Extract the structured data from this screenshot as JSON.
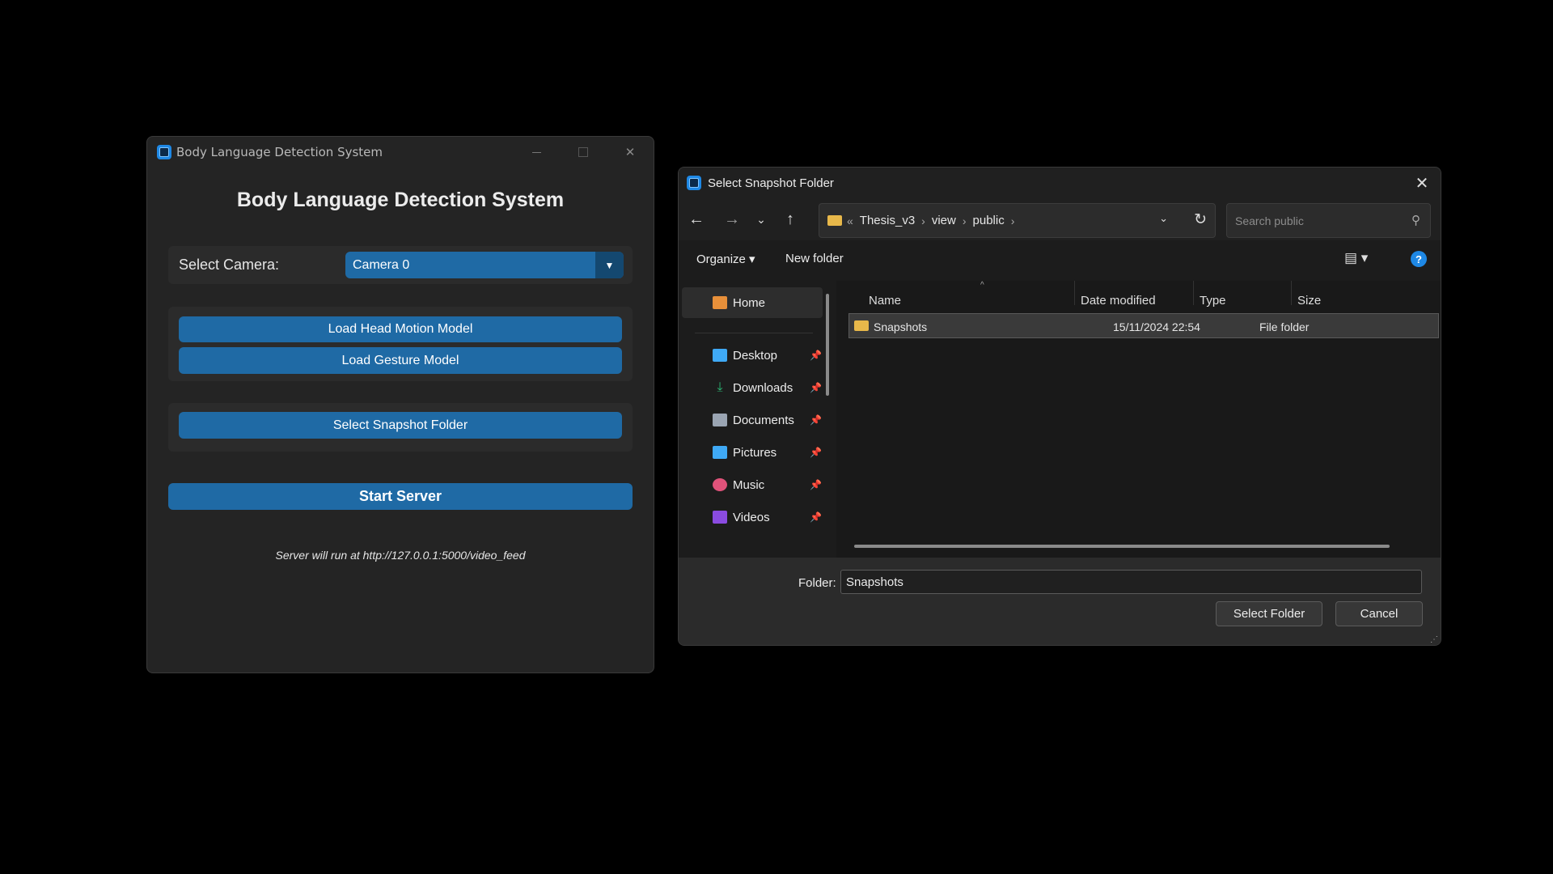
{
  "app": {
    "window_title": "Body Language Detection System",
    "heading": "Body Language Detection System",
    "camera_label": "Select Camera:",
    "camera_value": "Camera 0",
    "load_head_btn": "Load Head Motion Model",
    "load_gesture_btn": "Load Gesture Model",
    "select_snapshot_btn": "Select Snapshot Folder",
    "start_server_btn": "Start Server",
    "server_note": "Server will run at http://127.0.0.1:5000/video_feed",
    "accent_color": "#1f6aa5"
  },
  "dialog": {
    "title": "Select Snapshot Folder",
    "breadcrumb": [
      "Thesis_v3",
      "view",
      "public"
    ],
    "search_placeholder": "Search public",
    "organize": "Organize",
    "new_folder": "New folder",
    "nav": {
      "home": "Home",
      "items": [
        {
          "label": "Desktop",
          "icon": "desktop-icon",
          "color": "#3fa9f5"
        },
        {
          "label": "Downloads",
          "icon": "download-icon",
          "color": "#2bb673"
        },
        {
          "label": "Documents",
          "icon": "documents-icon",
          "color": "#9aa4b2"
        },
        {
          "label": "Pictures",
          "icon": "pictures-icon",
          "color": "#3fa9f5"
        },
        {
          "label": "Music",
          "icon": "music-icon",
          "color": "#e0527a"
        },
        {
          "label": "Videos",
          "icon": "videos-icon",
          "color": "#8a4be0"
        }
      ]
    },
    "columns": [
      "Name",
      "Date modified",
      "Type",
      "Size"
    ],
    "rows": [
      {
        "name": "Snapshots",
        "date": "15/11/2024 22:54",
        "type": "File folder"
      }
    ],
    "folder_label": "Folder:",
    "folder_value": "Snapshots",
    "select_btn": "Select Folder",
    "cancel_btn": "Cancel"
  }
}
